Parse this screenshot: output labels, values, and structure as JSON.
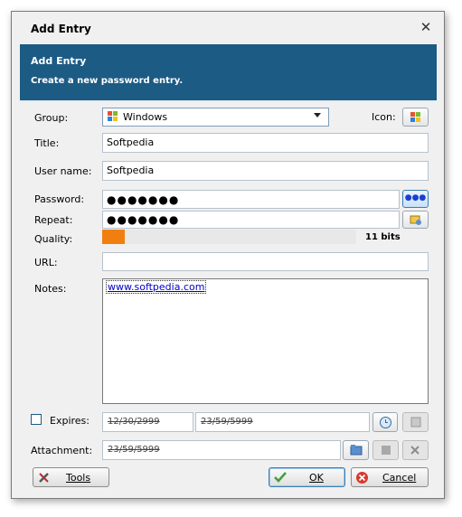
{
  "window": {
    "title": "Add Entry",
    "close_icon": "close-icon"
  },
  "banner": {
    "heading": "Add Entry",
    "subheading": "Create a new password entry."
  },
  "group": {
    "label": "Group:",
    "value": "Windows",
    "icon": "windows-icon"
  },
  "icon": {
    "label": "Icon:"
  },
  "title": {
    "label": "Title:",
    "value": "Softpedia"
  },
  "username": {
    "label": "User name:",
    "value": "Softpedia"
  },
  "password": {
    "label": "Password:",
    "value": "●●●●●●●",
    "toggle_label": "●●●"
  },
  "repeat": {
    "label": "Repeat:",
    "value": "●●●●●●●"
  },
  "quality": {
    "label": "Quality:",
    "bits": "11 bits",
    "level": 0.09,
    "color": "#f07f10"
  },
  "url": {
    "label": "URL:",
    "value": ""
  },
  "notes": {
    "label": "Notes:",
    "value": "www.softpedia.com"
  },
  "expires": {
    "label": "Expires:",
    "checked": false,
    "date": "12/30/2999",
    "time": "23/59/5999"
  },
  "attachment": {
    "label": "Attachment:",
    "value": "23/59/5999"
  },
  "buttons": {
    "tools": "Tools",
    "ok": "OK",
    "cancel": "Cancel"
  },
  "colors": {
    "banner": "#1c5b84",
    "accent": "#3c7fb1"
  }
}
